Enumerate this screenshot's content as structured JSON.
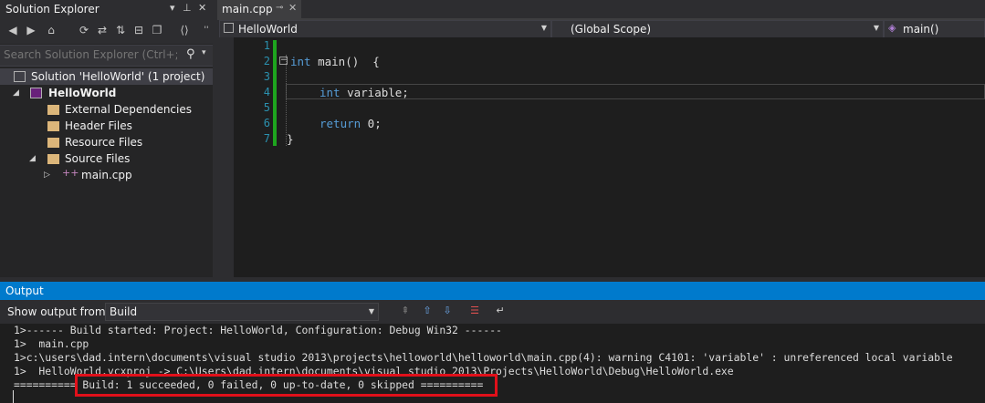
{
  "solution_explorer": {
    "title": "Solution Explorer",
    "search_placeholder": "Search Solution Explorer (Ctrl+;)",
    "tree": [
      {
        "label": "Solution 'HelloWorld' (1 project)",
        "bold": false
      },
      {
        "label": "HelloWorld",
        "bold": true
      },
      {
        "label": "External Dependencies"
      },
      {
        "label": "Header Files"
      },
      {
        "label": "Resource Files"
      },
      {
        "label": "Source Files"
      },
      {
        "label": "main.cpp"
      }
    ]
  },
  "editor": {
    "tab_label": "main.cpp",
    "nav": {
      "project": "HelloWorld",
      "scope": "(Global Scope)",
      "member": "main()"
    },
    "line_numbers": [
      "1",
      "2",
      "3",
      "4",
      "5",
      "6",
      "7"
    ],
    "code": [
      {
        "kw": "",
        "rest": ""
      },
      {
        "kw": "int",
        "rest": " main()  {"
      },
      {
        "kw": "",
        "rest": ""
      },
      {
        "kw": "int",
        "rest": " variable;"
      },
      {
        "kw": "",
        "rest": ""
      },
      {
        "kw": "return",
        "rest": " 0;"
      },
      {
        "kw": "",
        "rest": "}"
      }
    ]
  },
  "output": {
    "title": "Output",
    "show_from_label": "Show output from:",
    "source": "Build",
    "lines": [
      "1>------ Build started: Project: HelloWorld, Configuration: Debug Win32 ------",
      "1>  main.cpp",
      "1>c:\\users\\dad.intern\\documents\\visual studio 2013\\projects\\helloworld\\helloworld\\main.cpp(4): warning C4101: 'variable' : unreferenced local variable",
      "1>  HelloWorld.vcxproj -> C:\\Users\\dad.intern\\documents\\visual studio 2013\\Projects\\HelloWorld\\Debug\\HelloWorld.exe",
      "========== Build: 1 succeeded, 0 failed, 0 up-to-date, 0 skipped =========="
    ]
  },
  "colors": {
    "accent": "#007acc",
    "highlight": "#e1101a",
    "change_bar": "#1ea51e"
  }
}
